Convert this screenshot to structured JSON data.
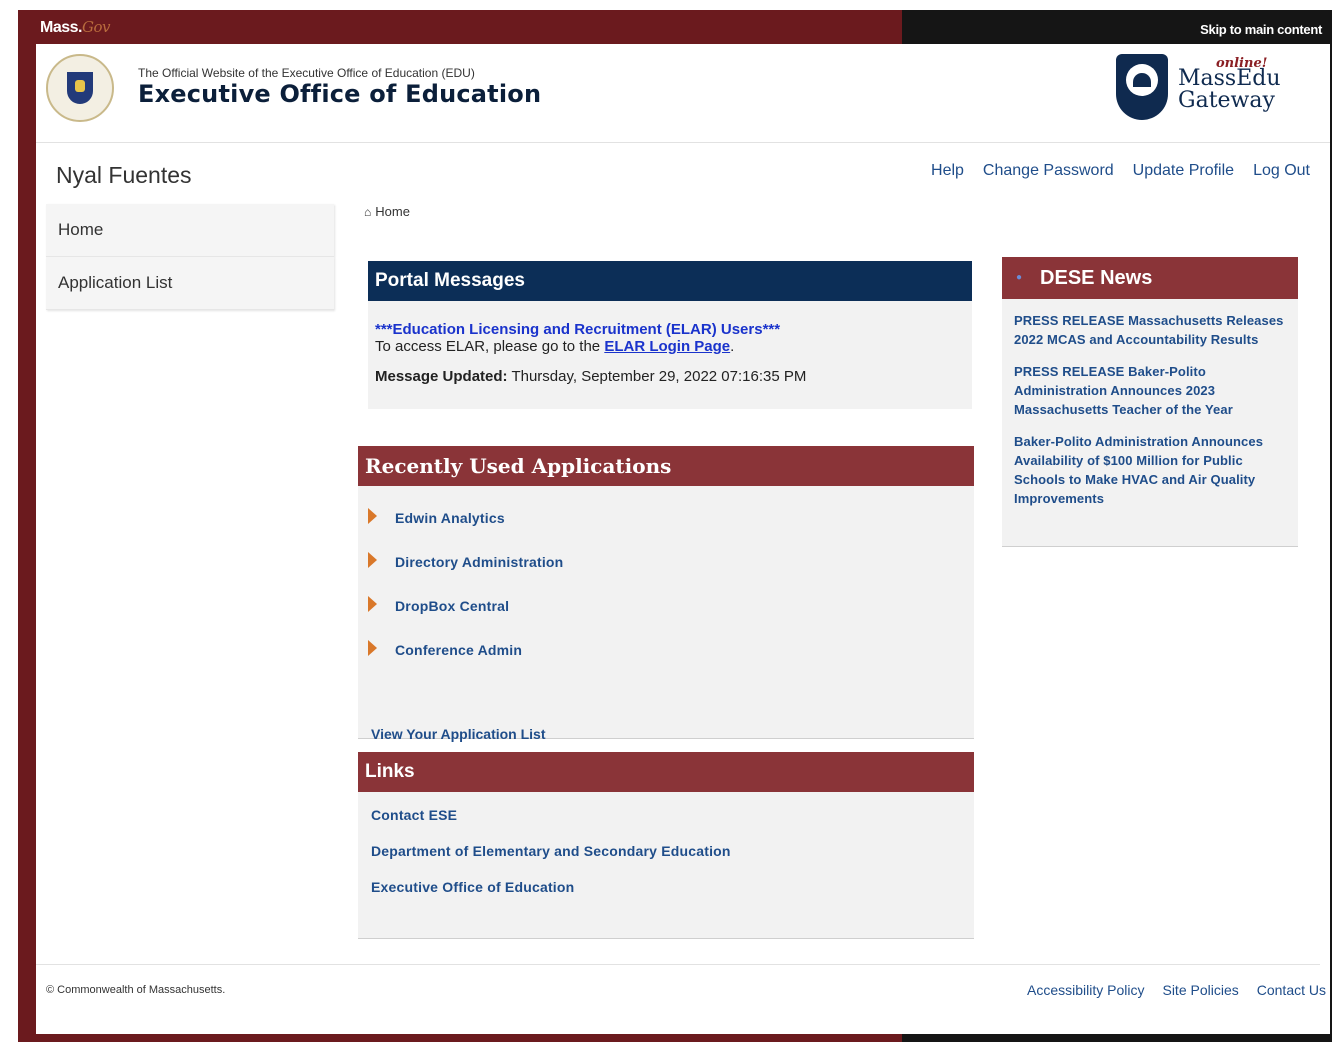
{
  "topbar": {
    "brand": "Mass.",
    "brand_suffix": "Gov",
    "skip_link": "Skip to main content"
  },
  "header": {
    "subtitle": "The Official Website of the Executive Office of Education (EDU)",
    "title": "Executive Office of Education",
    "gateway_tag": "online!",
    "gateway_line1": "MassEdu",
    "gateway_line2": "Gateway"
  },
  "user": {
    "name": "Nyal Fuentes"
  },
  "topnav": {
    "help": "Help",
    "change_password": "Change Password",
    "update_profile": "Update Profile",
    "log_out": "Log Out"
  },
  "sidebar": {
    "items": [
      {
        "label": "Home"
      },
      {
        "label": "Application List"
      }
    ]
  },
  "breadcrumb": {
    "home": "Home"
  },
  "portal": {
    "heading": "Portal Messages",
    "message_title": "***Education Licensing and Recruitment (ELAR) Users***",
    "message_prefix": "To access ELAR, please go to the",
    "elar_link": "ELAR Login Page",
    "message_suffix": ".",
    "updated_label": "Message Updated:",
    "updated_value": "Thursday, September 29, 2022 07:16:35 PM"
  },
  "recent": {
    "heading": "Recently Used Applications",
    "apps": [
      "Edwin Analytics",
      "Directory Administration",
      "DropBox Central",
      "Conference Admin"
    ],
    "view_all": "View Your Application List"
  },
  "links": {
    "heading": "Links",
    "items": [
      "Contact ESE",
      "Department of Elementary and Secondary Education",
      "Executive Office of Education"
    ]
  },
  "news": {
    "heading": "DESE News",
    "items": [
      "PRESS RELEASE Massachusetts Releases 2022 MCAS and Accountability Results",
      "PRESS RELEASE Baker-Polito Administration Announces 2023 Massachusetts Teacher of the Year",
      "Baker-Polito Administration Announces Availability of $100 Million for Public Schools to Make HVAC and Air Quality Improvements"
    ]
  },
  "footer": {
    "copyright": "© Commonwealth of Massachusetts.",
    "accessibility": "Accessibility Policy",
    "site_policies": "Site Policies",
    "contact": "Contact Us"
  },
  "colors": {
    "navy": "#0c2e57",
    "maroon": "#8a3438",
    "link": "#1f4d8a",
    "frame_left": "#6b1a1e",
    "frame_right": "#151515"
  }
}
